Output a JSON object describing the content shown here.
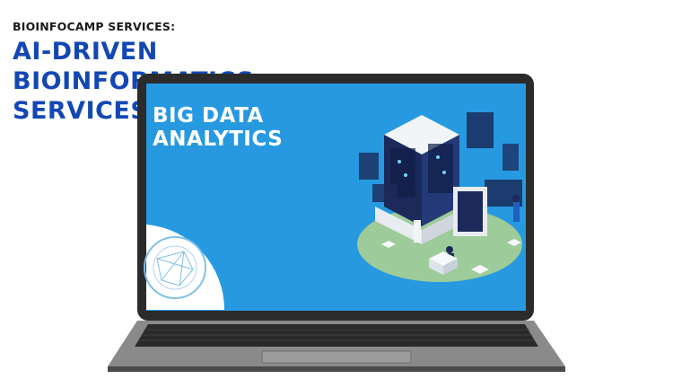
{
  "header": {
    "eyebrow": "BIOINFOCAMP SERVICES:",
    "headline": "AI-DRIVEN BIOINFORMATICS SERVICES"
  },
  "screen": {
    "title_line1": "BIG DATA",
    "title_line2": "ANALYTICS"
  },
  "colors": {
    "headline": "#1347b4",
    "screen_bg": "#2a9fe4",
    "laptop_frame": "#2b2b2b",
    "laptop_base": "#8a8a8a",
    "platform": "#9ecb9a"
  }
}
